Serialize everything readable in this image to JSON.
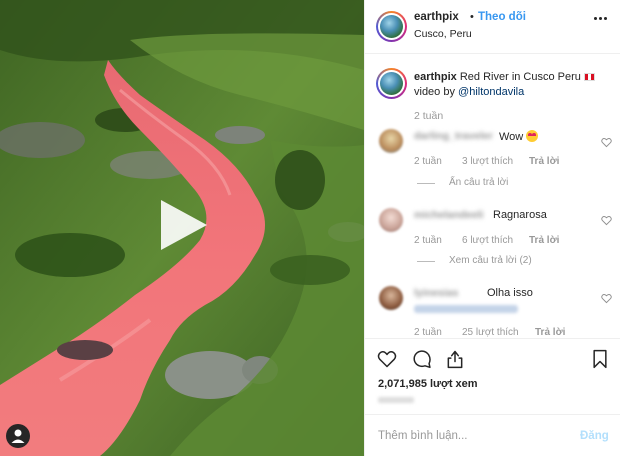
{
  "post": {
    "username": "earthpix",
    "separator": "•",
    "follow_label": "Theo dõi",
    "location": "Cusco, Peru",
    "more_icon": "more-horizontal-icon"
  },
  "caption": {
    "username": "earthpix",
    "text": " Red River in Cusco Peru ",
    "flag_icon": "peru-flag-icon",
    "credit_prefix": "video by ",
    "mention": "@hiltondavila",
    "time": "2 tuần"
  },
  "comments": [
    {
      "username": "darling_traveler",
      "text": "Wow ",
      "emoji": "heart-eyes-emoji",
      "time": "2 tuần",
      "likes": "3 lượt thích",
      "reply_label": "Trả lời",
      "thread_label": "Ẩn câu trả lời"
    },
    {
      "username": "michelandeeli",
      "text": "Ragnarosa",
      "time": "2 tuần",
      "likes": "6 lượt thích",
      "reply_label": "Trả lời",
      "thread_label": "Xem câu trả lời (2)"
    },
    {
      "username": "lyinesias",
      "text": "Olha isso",
      "time": "2 tuần",
      "likes": "25 lượt thích",
      "reply_label": "Trả lời"
    }
  ],
  "actions": {
    "like_icon": "heart-icon",
    "comment_icon": "comment-icon",
    "share_icon": "share-icon",
    "save_icon": "bookmark-icon"
  },
  "likes": {
    "count": "2,071,985",
    "label": " lượt xem"
  },
  "add_comment": {
    "placeholder": "Thêm bình luận...",
    "post_label": "Đăng"
  },
  "colors": {
    "link": "#3897f0",
    "river": "#f0696e",
    "grass": "#4e7a2e"
  }
}
